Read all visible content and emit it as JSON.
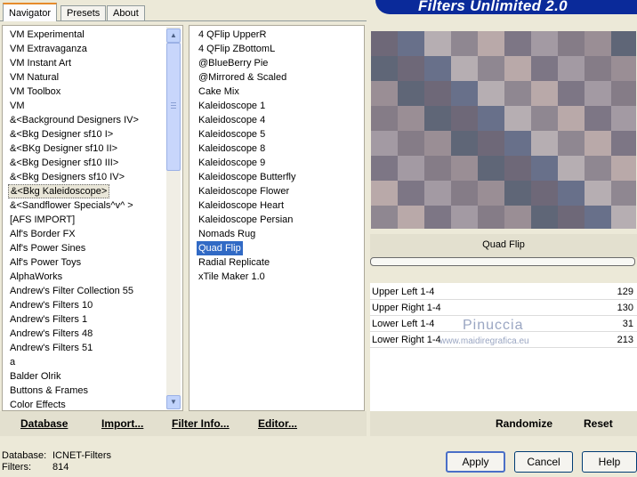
{
  "tabs": [
    "Navigator",
    "Presets",
    "About"
  ],
  "title": "Filters Unlimited 2.0",
  "categories": [
    "VM Experimental",
    "VM Extravaganza",
    "VM Instant Art",
    "VM Natural",
    "VM Toolbox",
    "VM",
    "&<Background Designers IV>",
    "&<Bkg Designer sf10 I>",
    "&<BKg Designer sf10 II>",
    "&<Bkg Designer sf10 III>",
    "&<Bkg Designers sf10 IV>",
    "&<Bkg Kaleidoscope>",
    "&<Sandflower Specials^v^ >",
    "[AFS IMPORT]",
    "Alf's Border FX",
    "Alf's Power Sines",
    "Alf's Power Toys",
    "AlphaWorks",
    "Andrew's Filter Collection 55",
    "Andrew's Filters 10",
    "Andrew's Filters 1",
    "Andrew's Filters 48",
    "Andrew's Filters 51",
    "a",
    "Balder Olrik",
    "Buttons & Frames",
    "Color Effects"
  ],
  "filters": [
    "4 QFlip UpperR",
    "4 QFlip ZBottomL",
    "@BlueBerry Pie",
    "@Mirrored & Scaled",
    "Cake Mix",
    "Kaleidoscope 1",
    "Kaleidoscope 4",
    "Kaleidoscope 5",
    "Kaleidoscope 8",
    "Kaleidoscope 9",
    "Kaleidoscope Butterfly",
    "Kaleidoscope Flower",
    "Kaleidoscope Heart",
    "Kaleidoscope Persian",
    "Nomads Rug",
    "Quad Flip",
    "Radial Replicate",
    "xTile Maker 1.0"
  ],
  "selected_category": "&<Bkg Kaleidoscope>",
  "selected_filter": "Quad Flip",
  "preview_label": "Quad Flip",
  "params": [
    {
      "label": "Upper Left 1-4",
      "value": "129"
    },
    {
      "label": "Upper Right 1-4",
      "value": "130"
    },
    {
      "label": "Lower Left 1-4",
      "value": "31"
    },
    {
      "label": "Lower Right 1-4",
      "value": "213"
    }
  ],
  "watermark": {
    "line1": "Pinuccia",
    "line2": "www.maidiregrafica.eu"
  },
  "bottom_links": {
    "database": "Database",
    "import": "Import...",
    "filter_info": "Filter Info...",
    "editor": "Editor..."
  },
  "randomize": "Randomize",
  "reset": "Reset",
  "status": {
    "database_label": "Database:",
    "database_value": "ICNET-Filters",
    "filters_label": "Filters:",
    "filters_value": "814"
  },
  "buttons": {
    "apply": "Apply",
    "cancel": "Cancel",
    "help": "Help"
  }
}
